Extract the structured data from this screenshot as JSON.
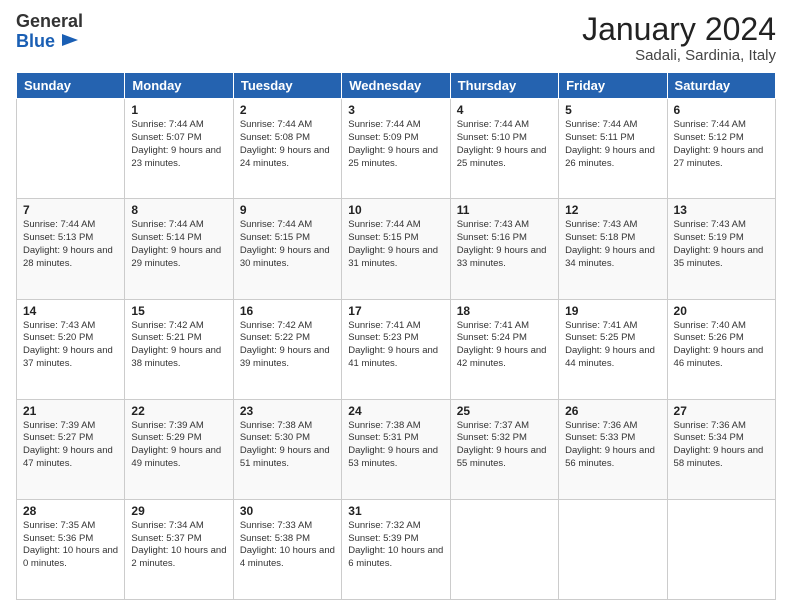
{
  "header": {
    "logo_general": "General",
    "logo_blue": "Blue",
    "month": "January 2024",
    "location": "Sadali, Sardinia, Italy"
  },
  "weekdays": [
    "Sunday",
    "Monday",
    "Tuesday",
    "Wednesday",
    "Thursday",
    "Friday",
    "Saturday"
  ],
  "weeks": [
    [
      {
        "day": "",
        "sunrise": "",
        "sunset": "",
        "daylight": ""
      },
      {
        "day": "1",
        "sunrise": "Sunrise: 7:44 AM",
        "sunset": "Sunset: 5:07 PM",
        "daylight": "Daylight: 9 hours and 23 minutes."
      },
      {
        "day": "2",
        "sunrise": "Sunrise: 7:44 AM",
        "sunset": "Sunset: 5:08 PM",
        "daylight": "Daylight: 9 hours and 24 minutes."
      },
      {
        "day": "3",
        "sunrise": "Sunrise: 7:44 AM",
        "sunset": "Sunset: 5:09 PM",
        "daylight": "Daylight: 9 hours and 25 minutes."
      },
      {
        "day": "4",
        "sunrise": "Sunrise: 7:44 AM",
        "sunset": "Sunset: 5:10 PM",
        "daylight": "Daylight: 9 hours and 25 minutes."
      },
      {
        "day": "5",
        "sunrise": "Sunrise: 7:44 AM",
        "sunset": "Sunset: 5:11 PM",
        "daylight": "Daylight: 9 hours and 26 minutes."
      },
      {
        "day": "6",
        "sunrise": "Sunrise: 7:44 AM",
        "sunset": "Sunset: 5:12 PM",
        "daylight": "Daylight: 9 hours and 27 minutes."
      }
    ],
    [
      {
        "day": "7",
        "sunrise": "Sunrise: 7:44 AM",
        "sunset": "Sunset: 5:13 PM",
        "daylight": "Daylight: 9 hours and 28 minutes."
      },
      {
        "day": "8",
        "sunrise": "Sunrise: 7:44 AM",
        "sunset": "Sunset: 5:14 PM",
        "daylight": "Daylight: 9 hours and 29 minutes."
      },
      {
        "day": "9",
        "sunrise": "Sunrise: 7:44 AM",
        "sunset": "Sunset: 5:15 PM",
        "daylight": "Daylight: 9 hours and 30 minutes."
      },
      {
        "day": "10",
        "sunrise": "Sunrise: 7:44 AM",
        "sunset": "Sunset: 5:15 PM",
        "daylight": "Daylight: 9 hours and 31 minutes."
      },
      {
        "day": "11",
        "sunrise": "Sunrise: 7:43 AM",
        "sunset": "Sunset: 5:16 PM",
        "daylight": "Daylight: 9 hours and 33 minutes."
      },
      {
        "day": "12",
        "sunrise": "Sunrise: 7:43 AM",
        "sunset": "Sunset: 5:18 PM",
        "daylight": "Daylight: 9 hours and 34 minutes."
      },
      {
        "day": "13",
        "sunrise": "Sunrise: 7:43 AM",
        "sunset": "Sunset: 5:19 PM",
        "daylight": "Daylight: 9 hours and 35 minutes."
      }
    ],
    [
      {
        "day": "14",
        "sunrise": "Sunrise: 7:43 AM",
        "sunset": "Sunset: 5:20 PM",
        "daylight": "Daylight: 9 hours and 37 minutes."
      },
      {
        "day": "15",
        "sunrise": "Sunrise: 7:42 AM",
        "sunset": "Sunset: 5:21 PM",
        "daylight": "Daylight: 9 hours and 38 minutes."
      },
      {
        "day": "16",
        "sunrise": "Sunrise: 7:42 AM",
        "sunset": "Sunset: 5:22 PM",
        "daylight": "Daylight: 9 hours and 39 minutes."
      },
      {
        "day": "17",
        "sunrise": "Sunrise: 7:41 AM",
        "sunset": "Sunset: 5:23 PM",
        "daylight": "Daylight: 9 hours and 41 minutes."
      },
      {
        "day": "18",
        "sunrise": "Sunrise: 7:41 AM",
        "sunset": "Sunset: 5:24 PM",
        "daylight": "Daylight: 9 hours and 42 minutes."
      },
      {
        "day": "19",
        "sunrise": "Sunrise: 7:41 AM",
        "sunset": "Sunset: 5:25 PM",
        "daylight": "Daylight: 9 hours and 44 minutes."
      },
      {
        "day": "20",
        "sunrise": "Sunrise: 7:40 AM",
        "sunset": "Sunset: 5:26 PM",
        "daylight": "Daylight: 9 hours and 46 minutes."
      }
    ],
    [
      {
        "day": "21",
        "sunrise": "Sunrise: 7:39 AM",
        "sunset": "Sunset: 5:27 PM",
        "daylight": "Daylight: 9 hours and 47 minutes."
      },
      {
        "day": "22",
        "sunrise": "Sunrise: 7:39 AM",
        "sunset": "Sunset: 5:29 PM",
        "daylight": "Daylight: 9 hours and 49 minutes."
      },
      {
        "day": "23",
        "sunrise": "Sunrise: 7:38 AM",
        "sunset": "Sunset: 5:30 PM",
        "daylight": "Daylight: 9 hours and 51 minutes."
      },
      {
        "day": "24",
        "sunrise": "Sunrise: 7:38 AM",
        "sunset": "Sunset: 5:31 PM",
        "daylight": "Daylight: 9 hours and 53 minutes."
      },
      {
        "day": "25",
        "sunrise": "Sunrise: 7:37 AM",
        "sunset": "Sunset: 5:32 PM",
        "daylight": "Daylight: 9 hours and 55 minutes."
      },
      {
        "day": "26",
        "sunrise": "Sunrise: 7:36 AM",
        "sunset": "Sunset: 5:33 PM",
        "daylight": "Daylight: 9 hours and 56 minutes."
      },
      {
        "day": "27",
        "sunrise": "Sunrise: 7:36 AM",
        "sunset": "Sunset: 5:34 PM",
        "daylight": "Daylight: 9 hours and 58 minutes."
      }
    ],
    [
      {
        "day": "28",
        "sunrise": "Sunrise: 7:35 AM",
        "sunset": "Sunset: 5:36 PM",
        "daylight": "Daylight: 10 hours and 0 minutes."
      },
      {
        "day": "29",
        "sunrise": "Sunrise: 7:34 AM",
        "sunset": "Sunset: 5:37 PM",
        "daylight": "Daylight: 10 hours and 2 minutes."
      },
      {
        "day": "30",
        "sunrise": "Sunrise: 7:33 AM",
        "sunset": "Sunset: 5:38 PM",
        "daylight": "Daylight: 10 hours and 4 minutes."
      },
      {
        "day": "31",
        "sunrise": "Sunrise: 7:32 AM",
        "sunset": "Sunset: 5:39 PM",
        "daylight": "Daylight: 10 hours and 6 minutes."
      },
      {
        "day": "",
        "sunrise": "",
        "sunset": "",
        "daylight": ""
      },
      {
        "day": "",
        "sunrise": "",
        "sunset": "",
        "daylight": ""
      },
      {
        "day": "",
        "sunrise": "",
        "sunset": "",
        "daylight": ""
      }
    ]
  ]
}
